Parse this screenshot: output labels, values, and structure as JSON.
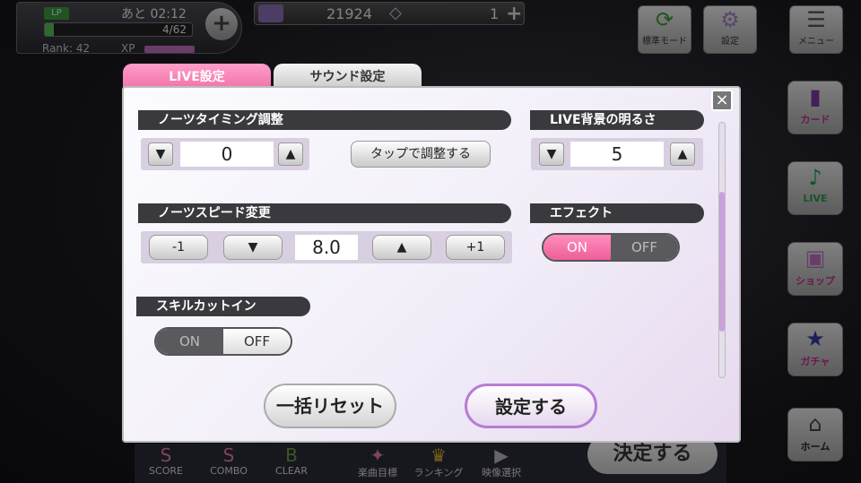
{
  "status": {
    "lp_label": "LP",
    "lp_time": "あと 02:12",
    "lp_count": "4/62",
    "lp_fill": 0.06,
    "rank": "Rank: 42",
    "xp_label": "XP"
  },
  "currency": {
    "coins": "21924",
    "gems": "1"
  },
  "top_buttons": {
    "standard_mode": "標準モード",
    "settings": "設定",
    "menu": "メニュー"
  },
  "side_buttons": {
    "card": "カード",
    "live": "LIVE",
    "shop": "ショップ",
    "gacha": "ガチャ",
    "home": "ホーム"
  },
  "bottom_bar": {
    "score": "SCORE",
    "combo": "COMBO",
    "clear": "CLEAR",
    "song_goal": "楽曲目標",
    "ranking": "ランキング",
    "video_select": "映像選択",
    "decide": "決定する"
  },
  "dialog": {
    "tabs": {
      "live": "LIVE設定",
      "sound": "サウンド設定"
    },
    "close": "×",
    "notes_timing": {
      "header": "ノーツタイミング調整",
      "value": "0",
      "tap_adjust": "タップで調整する"
    },
    "bg_brightness": {
      "header": "LIVE背景の明るさ",
      "value": "5"
    },
    "notes_speed": {
      "header": "ノーツスピード変更",
      "value": "8.0",
      "minus1": "-1",
      "plus1": "+1"
    },
    "effect": {
      "header": "エフェクト",
      "on": "ON",
      "off": "OFF",
      "state": "on"
    },
    "skill_cutin": {
      "header": "スキルカットイン",
      "on": "ON",
      "off": "OFF",
      "state": "off"
    },
    "scroll_position": 0.6,
    "reset": "一括リセット",
    "confirm": "設定する"
  },
  "icons": {
    "down": "▼",
    "up": "▲"
  }
}
